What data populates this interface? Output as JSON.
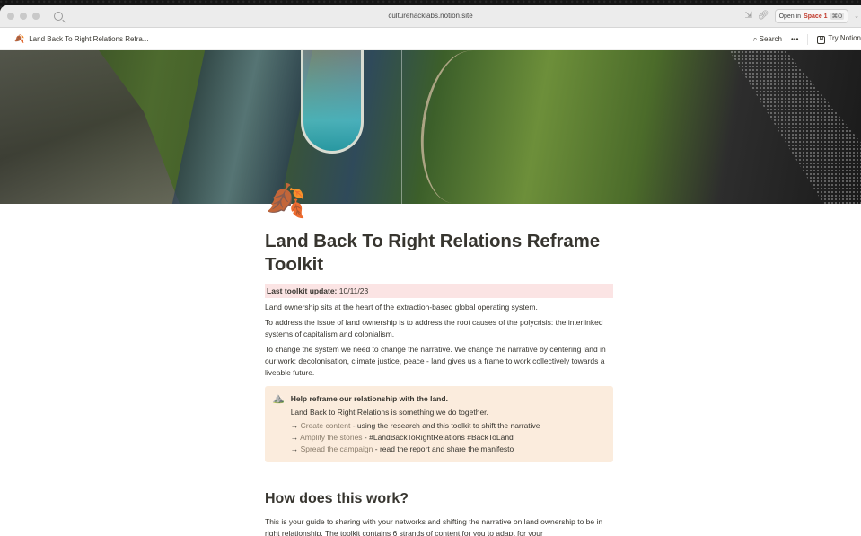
{
  "browser": {
    "url": "culturehacklabs.notion.site",
    "open_in_label": "Open in",
    "space_label": "Space 1",
    "shortcut": "⌘O"
  },
  "notion_bar": {
    "breadcrumb": "Land Back To Right Relations Refra...",
    "search_label": "Search",
    "more_label": "•••",
    "try_notion_label": "Try Notion"
  },
  "page": {
    "title": "Land Back To Right Relations Reframe Toolkit",
    "update_label": "Last toolkit update:",
    "update_value": " 10/11/23",
    "paragraphs": [
      "Land ownership sits at the heart of the extraction-based global operating system.",
      "To address the issue of land ownership is to address the root causes of the polycrisis: the interlinked systems of capitalism and colonialism.",
      "To change the system we need to change the narrative. We change the narrative by centering land in our work: decolonisation, climate justice, peace - land gives us a frame to work collectively towards a liveable future."
    ],
    "callout": {
      "title": "Help reframe our relationship with the land.",
      "subtitle": "Land Back to Right Relations is something we do together.",
      "items": [
        {
          "arrow": "→ ",
          "link": "Create content",
          "rest": " - using the research and this toolkit to shift the narrative"
        },
        {
          "arrow": "→ ",
          "link": "Amplify the stories",
          "rest": " - #LandBackToRightRelations #BackToLand"
        },
        {
          "arrow": "→ ",
          "link": "Spread the campaign",
          "rest": " - read the report and share the manifesto"
        }
      ]
    },
    "section_heading": "How does this work?",
    "section_text": "This is your guide to sharing with your networks and shifting the narrative on land ownership to be in right relationship. The toolkit contains 6 strands of content for you to adapt for your"
  }
}
